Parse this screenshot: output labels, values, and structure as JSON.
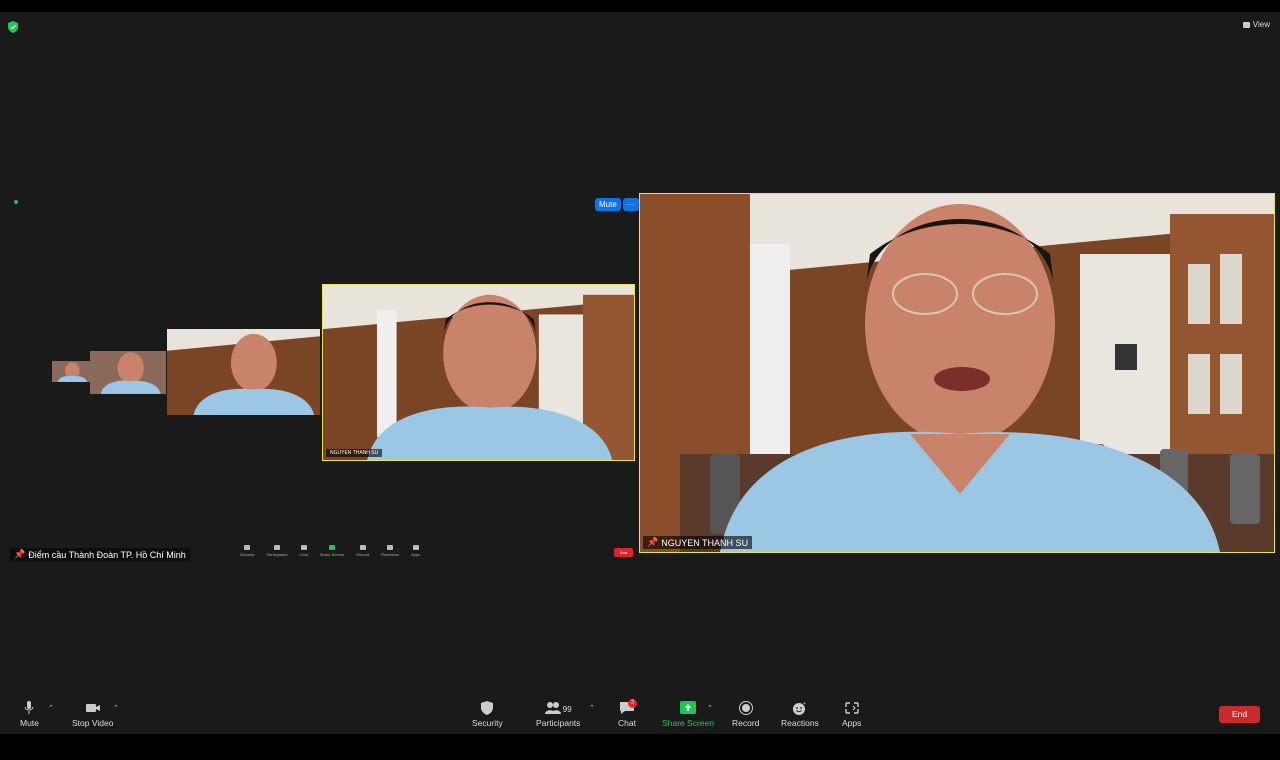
{
  "window": {
    "view_label": "View"
  },
  "main_tile": {
    "name": "NGUYEN THANH SU"
  },
  "nested_tile": {
    "name": "NGUYEN THANH SU"
  },
  "nested_left": {
    "name": "Điểm cầu Thành Đoàn TP. Hồ Chí Minh",
    "mute_label": "Mute",
    "more_label": "···",
    "end_label": "End"
  },
  "toolbar": {
    "mute": "Mute",
    "stop_video": "Stop Video",
    "security": "Security",
    "participants": "Participants",
    "participants_count": "99",
    "chat": "Chat",
    "chat_badge": "3",
    "share_screen": "Share Screen",
    "record": "Record",
    "reactions": "Reactions",
    "apps": "Apps",
    "end": "End"
  },
  "mini_toolbar": [
    "Security",
    "Participants",
    "Chat",
    "Share Screen",
    "Record",
    "Reactions",
    "Apps"
  ],
  "colors": {
    "active_border": "#e4e35a",
    "share_green": "#23c552",
    "end_red": "#c92a2a",
    "mute_blue": "#0e72ed"
  }
}
